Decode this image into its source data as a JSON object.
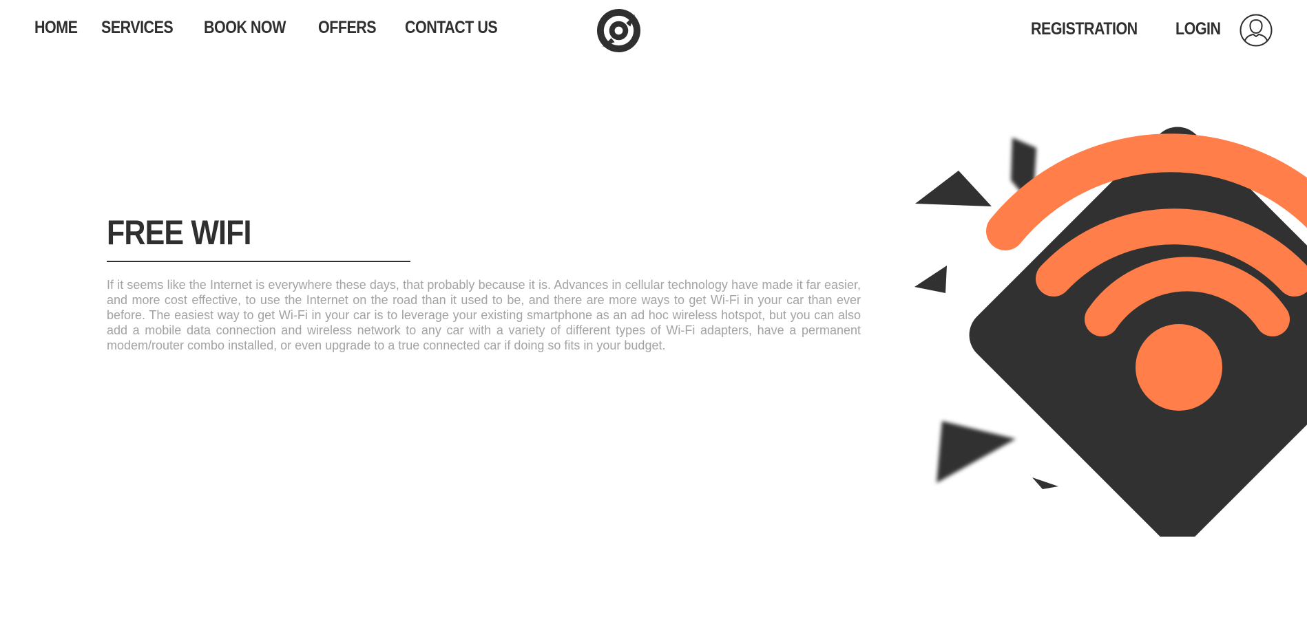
{
  "nav": {
    "left": [
      {
        "label": "HOME"
      },
      {
        "label": "SERVICES"
      },
      {
        "label": "BOOK NOW"
      },
      {
        "label": "OFFERS"
      },
      {
        "label": "CONTACT US"
      }
    ],
    "right": [
      {
        "label": "REGISTRATION"
      },
      {
        "label": "LOGIN"
      }
    ],
    "logo_icon": "target-logo-icon",
    "avatar_icon": "user-icon"
  },
  "main": {
    "title": "FREE WIFI",
    "paragraph": "If it seems like the Internet is everywhere these days, that probably because it is. Advances in cellular technology have made it far easier, and more cost effective, to use the Internet on the road than it used to be, and there are more ways to get Wi-Fi in your car than ever before. The easiest way to get Wi-Fi in your car is to leverage your existing smartphone as an ad hoc wireless hotspot, but you can also add a mobile data connection and wireless network to any car with a variety of different types of Wi-Fi adapters, have a permanent modem/router combo installed, or even upgrade to a true connected car if doing so fits in your budget."
  },
  "illustration": {
    "icon": "wifi-icon",
    "colors": {
      "dark": "#313131",
      "accent": "#ff7e4a"
    }
  }
}
